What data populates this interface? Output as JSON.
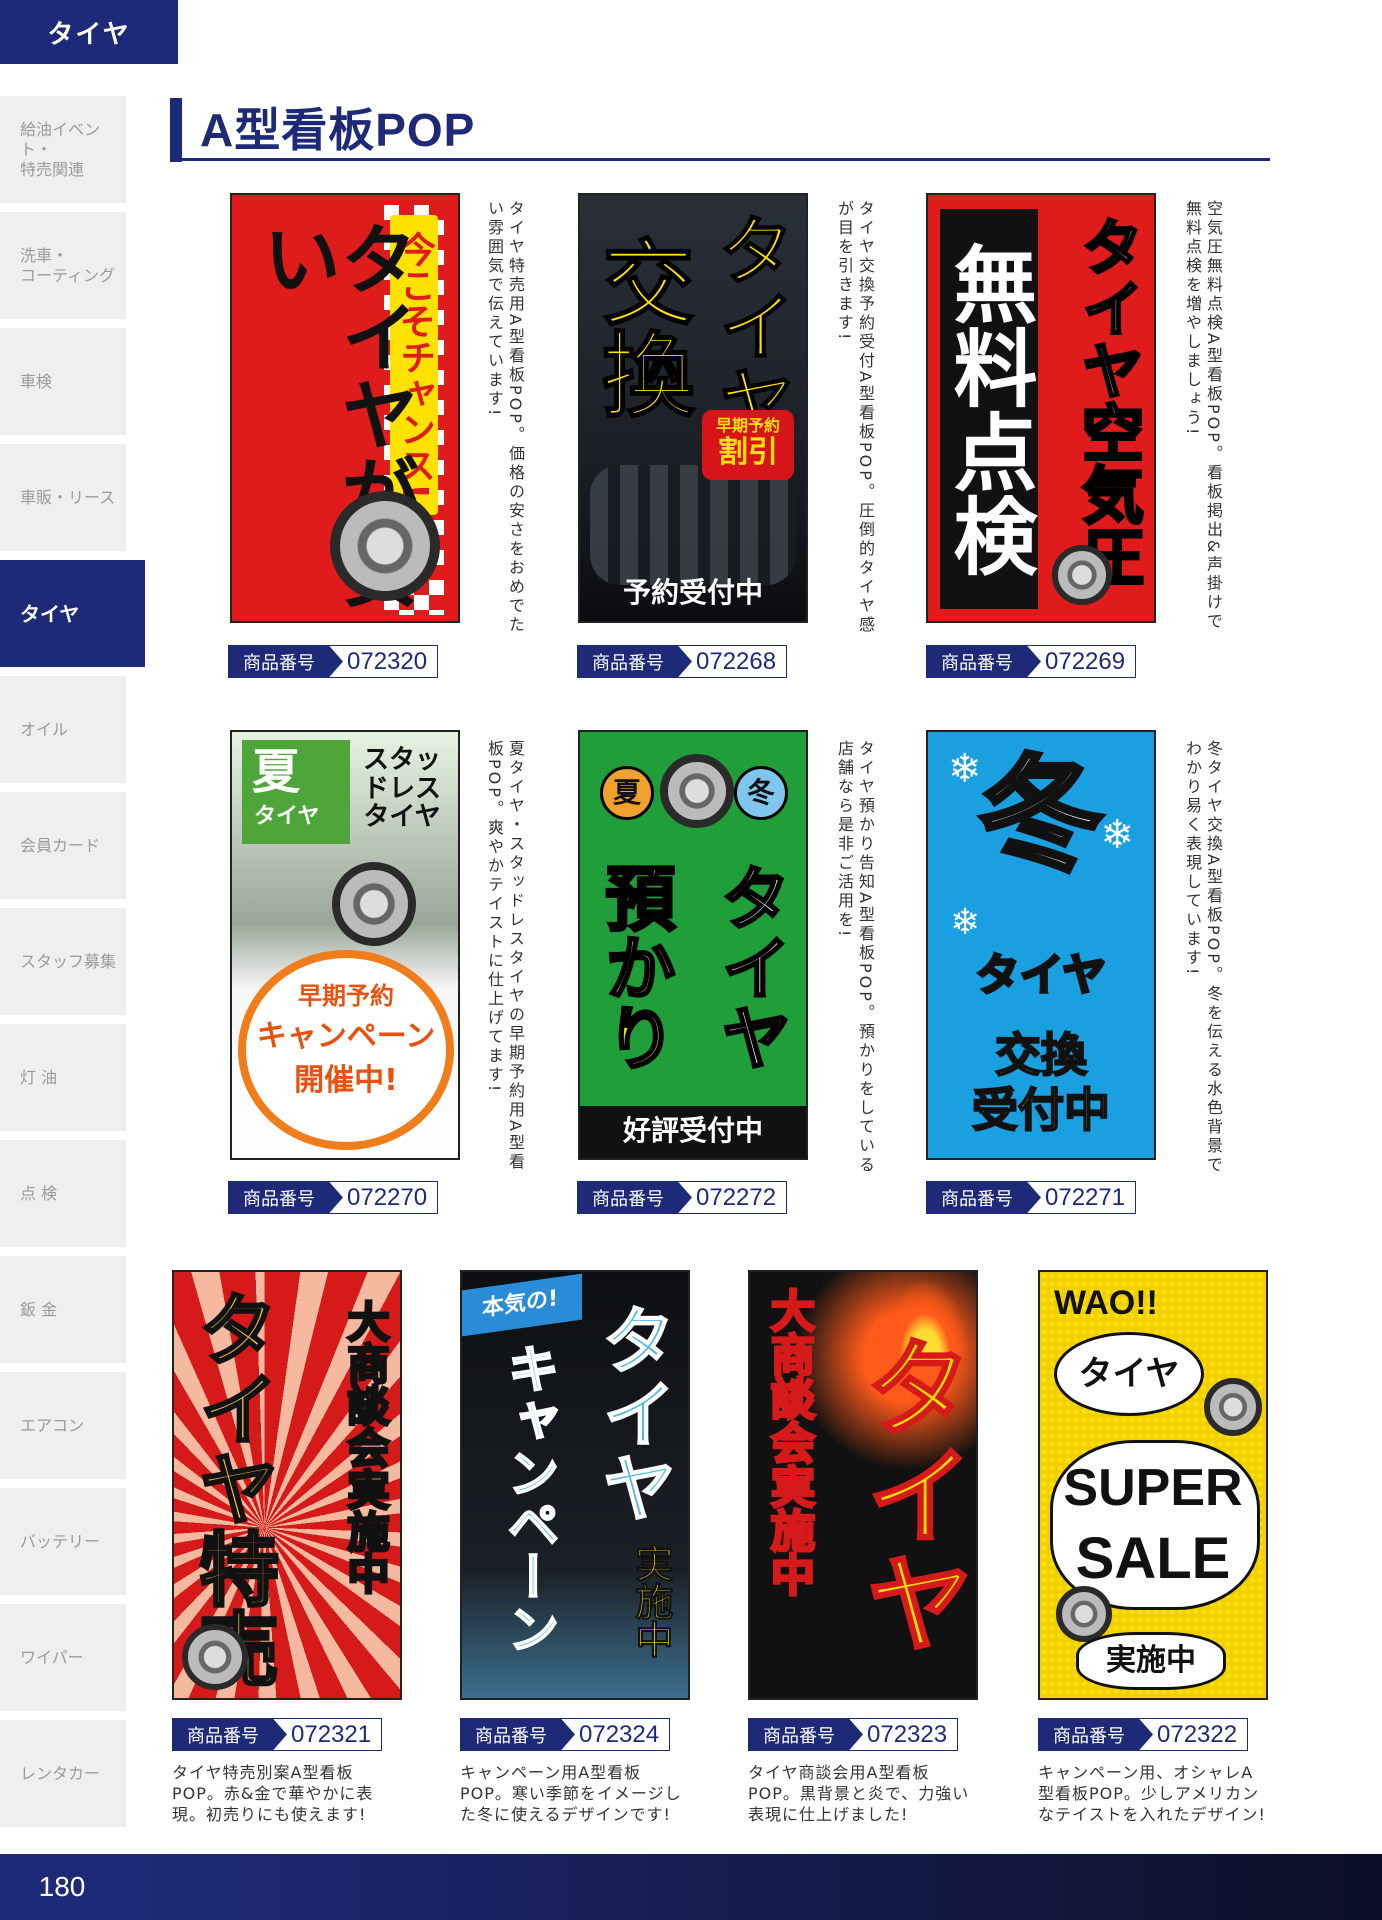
{
  "top_tab": "タイヤ",
  "sidebar": {
    "items": [
      {
        "label": "給油イベント・\n特売関連"
      },
      {
        "label": "洗車・\nコーティング"
      },
      {
        "label": "車検"
      },
      {
        "label": "車販・リース"
      },
      {
        "label": "タイヤ"
      },
      {
        "label": "オイル"
      },
      {
        "label": "会員カード"
      },
      {
        "label": "スタッフ募集"
      },
      {
        "label": "灯 油"
      },
      {
        "label": "点 検"
      },
      {
        "label": "鈑 金"
      },
      {
        "label": "エアコン"
      },
      {
        "label": "バッテリー"
      },
      {
        "label": "ワイパー"
      },
      {
        "label": "レンタカー"
      }
    ],
    "active_index": 4
  },
  "page": {
    "title": "A型看板POP",
    "number": "180"
  },
  "code_label": "商品番号",
  "products": [
    {
      "code": "072320",
      "desc": "タイヤ特売用A型看板POP。価格の安さをおめでたい雰囲気で伝えています!",
      "poster": {
        "lines": [
          "今こそチャンス!",
          "タイヤが安い"
        ]
      }
    },
    {
      "code": "072268",
      "desc": "タイヤ交換予約受付A型看板POP。圧倒的タイヤ感が目を引きます!",
      "poster": {
        "lines": [
          "タイヤ",
          "交換",
          "早期予約",
          "割引",
          "予約受付中"
        ]
      }
    },
    {
      "code": "072269",
      "desc": "空気圧無料点検A型看板POP。看板掲出&声掛けで無料点検を増やしましょう!",
      "poster": {
        "lines": [
          "タイヤ空気圧",
          "無料点検"
        ]
      }
    },
    {
      "code": "072270",
      "desc": "夏タイヤ・スタッドレスタイヤの早期予約用A型看板POP。爽やかテイストに仕上げてます!",
      "poster": {
        "lines": [
          "夏",
          "タイヤ",
          "スタッドレスタイヤ",
          "早期予約",
          "キャンペーン",
          "開催中!"
        ]
      }
    },
    {
      "code": "072272",
      "desc": "タイヤ預かり告知A型看板POP。預かりをしている店舗なら是非ご活用を!",
      "poster": {
        "lines": [
          "夏",
          "冬",
          "タイヤ",
          "預かり",
          "好評受付中"
        ]
      }
    },
    {
      "code": "072271",
      "desc": "冬タイヤ交換A型看板POP。冬を伝える水色背景でわかり易く表現しています!",
      "poster": {
        "lines": [
          "冬",
          "タイヤ",
          "交換",
          "受付中"
        ]
      }
    },
    {
      "code": "072321",
      "desc": "タイヤ特売別案A型看板POP。赤&金で華やかに表現。初売りにも使えます!",
      "poster": {
        "lines": [
          "大商談会実施中",
          "タイヤ特売"
        ]
      }
    },
    {
      "code": "072324",
      "desc": "キャンペーン用A型看板POP。寒い季節をイメージした冬に使えるデザインです!",
      "poster": {
        "lines": [
          "本気の!",
          "タイヤ",
          "キャンペーン",
          "実施中"
        ]
      }
    },
    {
      "code": "072323",
      "desc": "タイヤ商談会用A型看板POP。黒背景と炎で、力強い表現に仕上げました!",
      "poster": {
        "lines": [
          "大商談会実施中",
          "タイヤ"
        ]
      }
    },
    {
      "code": "072322",
      "desc": "キャンペーン用、オシャレA型看板POP。少しアメリカンなテイストを入れたデザイン!",
      "poster": {
        "lines": [
          "WAO!!",
          "タイヤ",
          "SUPER",
          "SALE",
          "実施中"
        ]
      }
    }
  ],
  "colors": {
    "brand": "#1e2a78",
    "sidebar_bg": "#efefef",
    "sidebar_text": "#9b9b9b"
  }
}
